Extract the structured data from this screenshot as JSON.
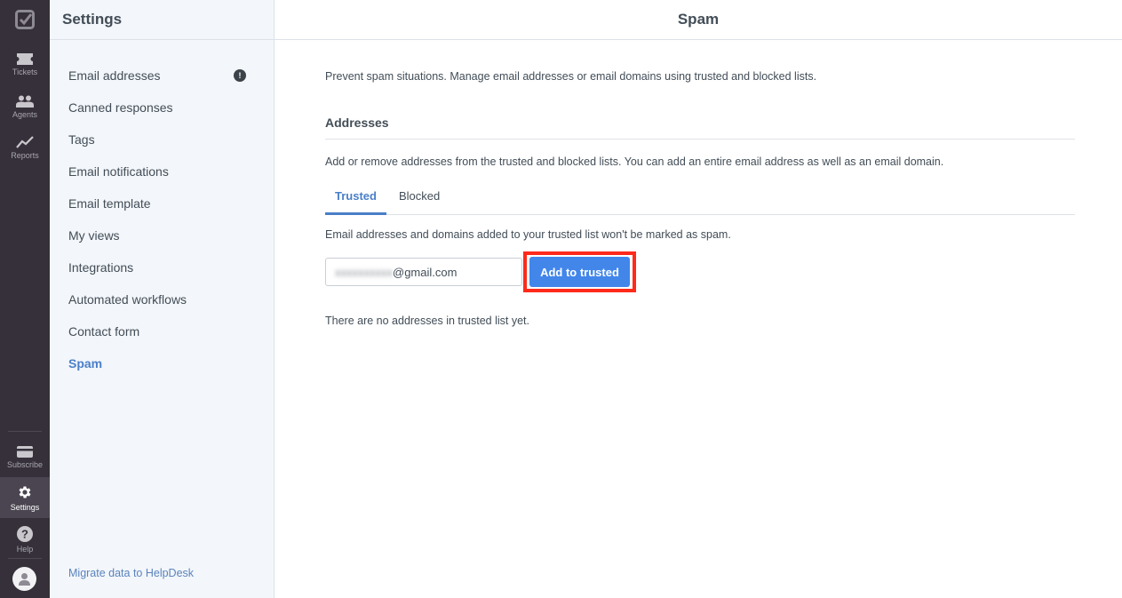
{
  "rail": {
    "items": [
      {
        "label": "Tickets",
        "icon": "ticket-icon"
      },
      {
        "label": "Agents",
        "icon": "agents-icon"
      },
      {
        "label": "Reports",
        "icon": "reports-icon"
      }
    ],
    "bottom_items": [
      {
        "label": "Subscribe",
        "icon": "subscribe-icon"
      },
      {
        "label": "Settings",
        "icon": "gear-icon",
        "active": true
      },
      {
        "label": "Help",
        "icon": "help-icon"
      }
    ]
  },
  "sidebar": {
    "title": "Settings",
    "items": [
      {
        "label": "Email addresses",
        "badge": "!"
      },
      {
        "label": "Canned responses"
      },
      {
        "label": "Tags"
      },
      {
        "label": "Email notifications"
      },
      {
        "label": "Email template"
      },
      {
        "label": "My views"
      },
      {
        "label": "Integrations"
      },
      {
        "label": "Automated workflows"
      },
      {
        "label": "Contact form"
      },
      {
        "label": "Spam",
        "active": true
      }
    ],
    "footer_link": "Migrate data to HelpDesk"
  },
  "main": {
    "title": "Spam",
    "intro": "Prevent spam situations. Manage email addresses or email domains using trusted and blocked lists.",
    "section": {
      "title": "Addresses",
      "description": "Add or remove addresses from the trusted and blocked lists. You can add an entire email address as well as an email domain."
    },
    "tabs": [
      {
        "label": "Trusted",
        "active": true
      },
      {
        "label": "Blocked"
      }
    ],
    "tab_description": "Email addresses and domains added to your trusted list won't be marked as spam.",
    "email_input": {
      "value_blurred": "xxxxxxxxxx",
      "value_domain": "@gmail.com"
    },
    "add_button": "Add to trusted",
    "empty_state": "There are no addresses in trusted list yet.",
    "colors": {
      "accent": "#4a7fc8",
      "button": "#4286ea",
      "highlight": "#ff2a1a"
    }
  }
}
